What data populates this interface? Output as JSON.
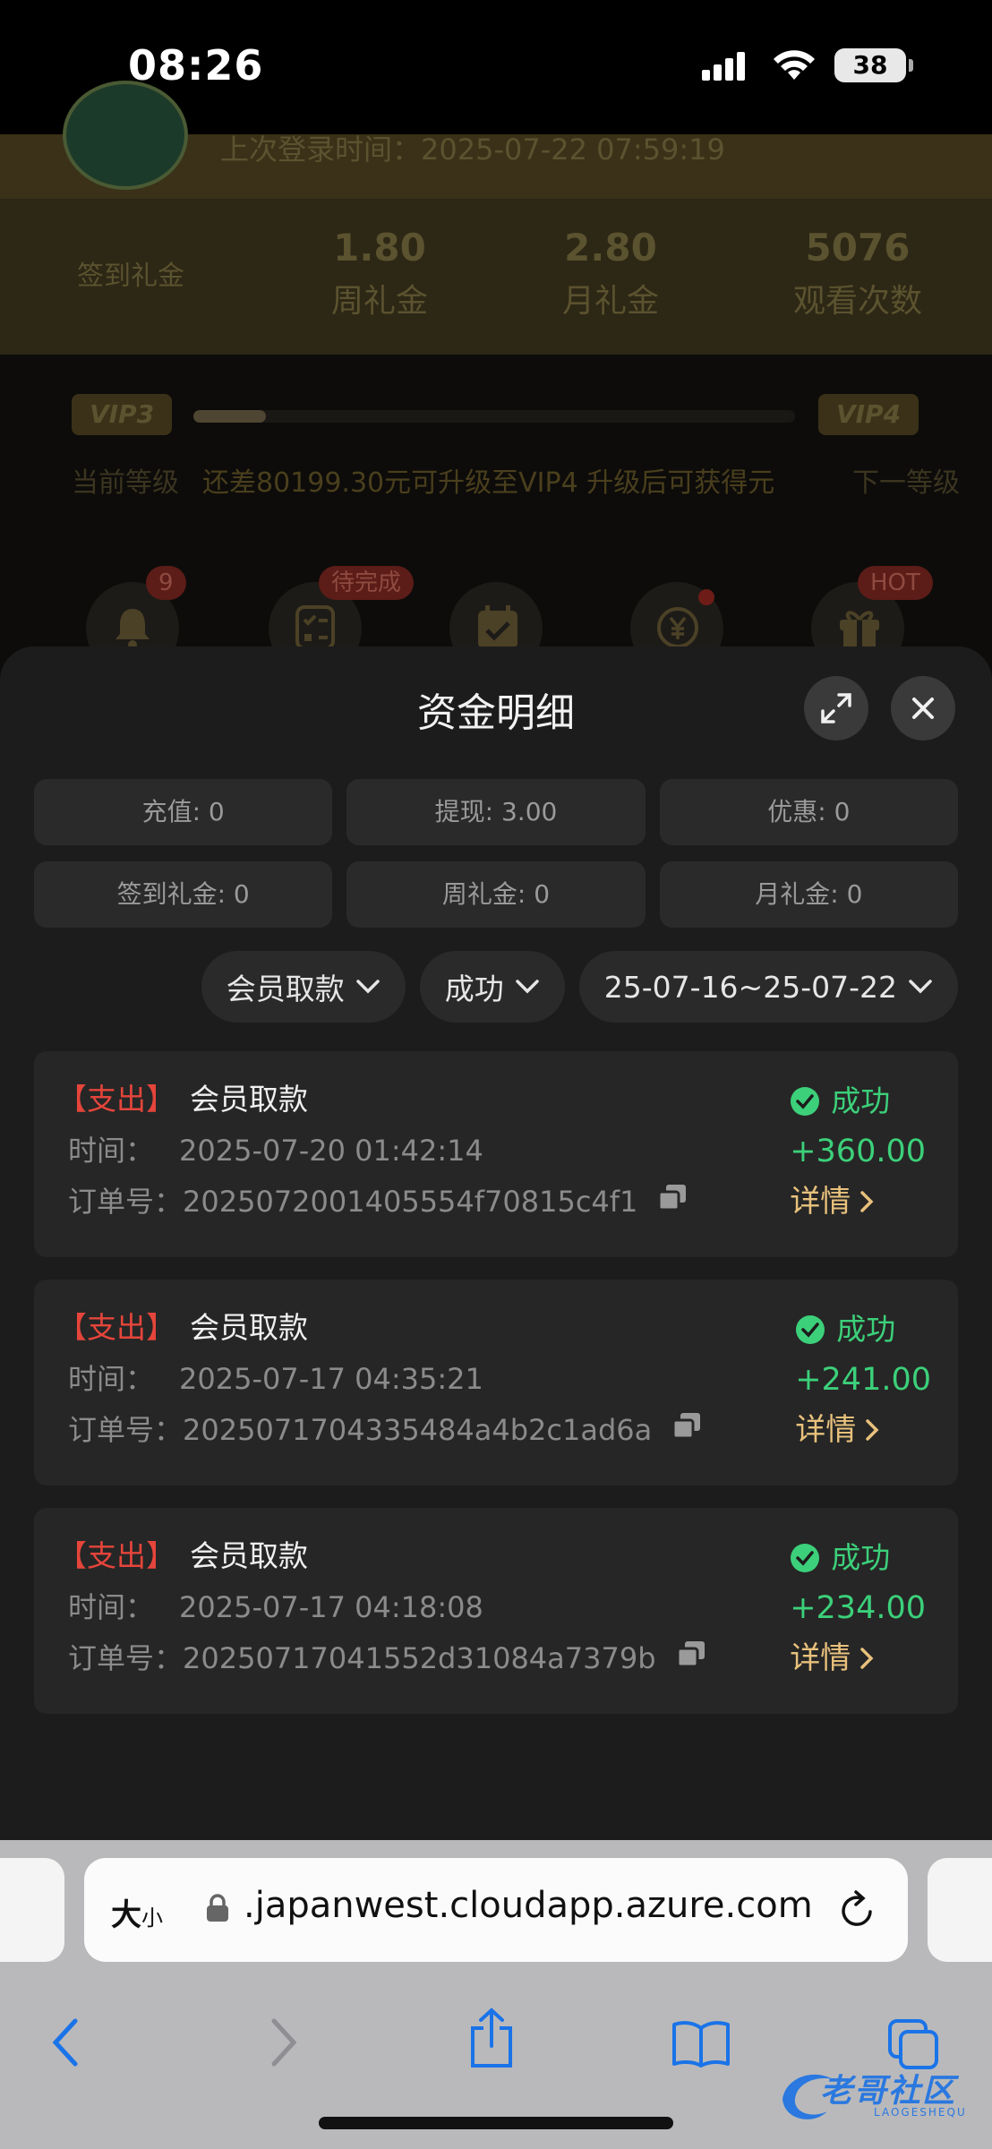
{
  "status_bar": {
    "time": "08:26",
    "battery": "38"
  },
  "background": {
    "last_login": "上次登录时间：2025-07-22 07:59:19",
    "stats": [
      {
        "label": "签到礼金"
      },
      {
        "value": "1.80",
        "label": "周礼金"
      },
      {
        "value": "2.80",
        "label": "月礼金"
      },
      {
        "value": "5076",
        "label": "观看次数"
      }
    ],
    "vip": {
      "current": "VIP3",
      "next": "VIP4",
      "progress": 0.12,
      "current_label": "当前等级",
      "upgrade_text": "还差80199.30元可升级至VIP4 升级后可获得元",
      "next_label": "下一等级"
    },
    "tags": {
      "notify_count": "9",
      "task": "待完成",
      "gift": "HOT"
    }
  },
  "sheet": {
    "title": "资金明细",
    "summary": [
      "充值: 0",
      "提现: 3.00",
      "优惠: 0",
      "签到礼金: 0",
      "周礼金: 0",
      "月礼金: 0"
    ],
    "filters": {
      "type": "会员取款",
      "status": "成功",
      "date_range": "25-07-16~25-07-22"
    },
    "records": [
      {
        "type": "【支出】",
        "name": "会员取款",
        "time_label": "时间：",
        "time": "2025-07-20 01:42:14",
        "order_label": "订单号：",
        "order": "2025072001405554f70815c4f1",
        "status": "成功",
        "amount": "+360.00",
        "detail": "详情"
      },
      {
        "type": "【支出】",
        "name": "会员取款",
        "time_label": "时间：",
        "time": "2025-07-17 04:35:21",
        "order_label": "订单号：",
        "order": "2025071704335484a4b2c1ad6a",
        "status": "成功",
        "amount": "+241.00",
        "detail": "详情"
      },
      {
        "type": "【支出】",
        "name": "会员取款",
        "time_label": "时间：",
        "time": "2025-07-17 04:18:08",
        "order_label": "订单号：",
        "order": "20250717041552d31084a7379b",
        "status": "成功",
        "amount": "+234.00",
        "detail": "详情"
      }
    ]
  },
  "browser": {
    "text_size_big": "大",
    "text_size_small": "小",
    "url": ".japanwest.cloudapp.azure.com"
  },
  "watermark": {
    "text": "老哥社区",
    "sub": "LAOGESHEQU"
  },
  "colors": {
    "success": "#3cd07a",
    "expense": "#e5453b",
    "detail": "#e8c17c",
    "sheet_bg": "#1c1c1c"
  }
}
